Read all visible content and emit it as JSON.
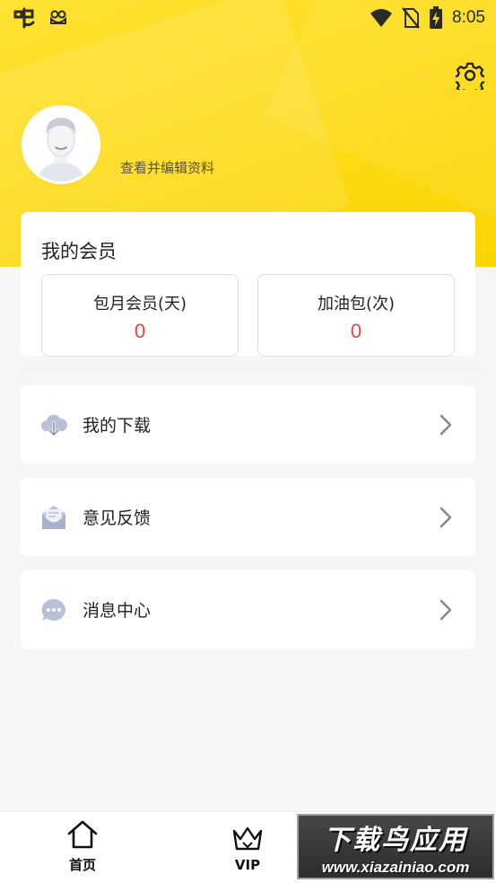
{
  "status_bar": {
    "time": "8:05",
    "left_icons": [
      "app-logo-icon",
      "frog-icon"
    ],
    "right_icons": [
      "wifi-icon",
      "no-sim-icon",
      "battery-charging-icon"
    ]
  },
  "header": {
    "background_color": "#fddc1c",
    "edit_profile_text": "查看并编辑资料",
    "settings_icon": "gear-icon"
  },
  "membership": {
    "title": "我的会员",
    "monthly_label": "包月会员(天)",
    "monthly_count": "0",
    "boost_label": "加油包(次)",
    "boost_count": "0",
    "count_color": "#f0443a"
  },
  "menu": {
    "items": [
      {
        "label": "我的下载",
        "icon": "cloud-download-icon"
      },
      {
        "label": "意见反馈",
        "icon": "envelope-icon"
      },
      {
        "label": "消息中心",
        "icon": "chat-bubble-icon"
      }
    ]
  },
  "bottom_nav": {
    "home_label": "首页",
    "vip_label": "VIP"
  },
  "watermark": {
    "title": "下载鸟应用",
    "url": "www.xiazainiao.com"
  }
}
